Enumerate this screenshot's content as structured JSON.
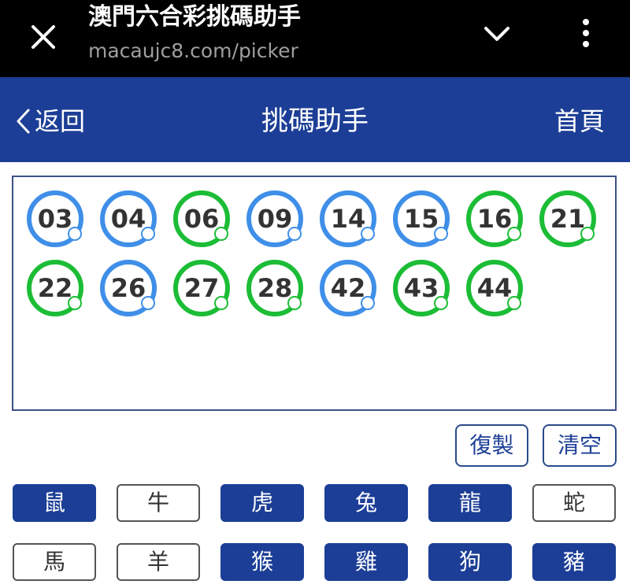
{
  "browser": {
    "title": "澳門六合彩挑碼助手",
    "url": "macaujc8.com/picker",
    "icons": {
      "close": "close-icon",
      "collapse": "chevron-down-icon",
      "menu": "more-vertical-icon"
    }
  },
  "header": {
    "back_label": "返回",
    "title": "挑碼助手",
    "home_label": "首頁",
    "color": "#1c3e96"
  },
  "balls": [
    {
      "num": "03",
      "color": "blue"
    },
    {
      "num": "04",
      "color": "blue"
    },
    {
      "num": "06",
      "color": "green"
    },
    {
      "num": "09",
      "color": "blue"
    },
    {
      "num": "14",
      "color": "blue"
    },
    {
      "num": "15",
      "color": "blue"
    },
    {
      "num": "16",
      "color": "green"
    },
    {
      "num": "21",
      "color": "green"
    },
    {
      "num": "22",
      "color": "green"
    },
    {
      "num": "26",
      "color": "blue"
    },
    {
      "num": "27",
      "color": "green"
    },
    {
      "num": "28",
      "color": "green"
    },
    {
      "num": "42",
      "color": "blue"
    },
    {
      "num": "43",
      "color": "green"
    },
    {
      "num": "44",
      "color": "green"
    }
  ],
  "ball_colors": {
    "blue": "#3f8fe8",
    "green": "#1cbd36"
  },
  "actions": {
    "copy_label": "復製",
    "clear_label": "清空"
  },
  "zodiacs": [
    {
      "label": "鼠",
      "selected": true
    },
    {
      "label": "牛",
      "selected": false
    },
    {
      "label": "虎",
      "selected": true
    },
    {
      "label": "兔",
      "selected": true
    },
    {
      "label": "龍",
      "selected": true
    },
    {
      "label": "蛇",
      "selected": false
    },
    {
      "label": "馬",
      "selected": false
    },
    {
      "label": "羊",
      "selected": false
    },
    {
      "label": "猴",
      "selected": true
    },
    {
      "label": "雞",
      "selected": true
    },
    {
      "label": "狗",
      "selected": true
    },
    {
      "label": "豬",
      "selected": true
    }
  ]
}
